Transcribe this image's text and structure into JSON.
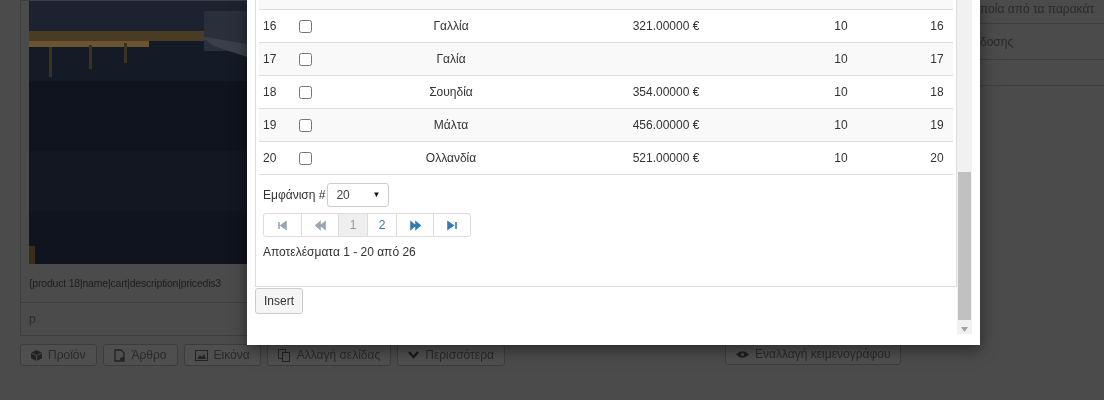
{
  "background": {
    "shortcode": "{product 18|name|cart|description|pricedis3",
    "paragraph_tag": "p",
    "right_texts": [
      "ποία από τα παρακάτ",
      "δοσης"
    ],
    "toolbar": [
      {
        "label": "Προϊόν"
      },
      {
        "label": "Άρθρο"
      },
      {
        "label": "Εικόνα"
      },
      {
        "label": "Αλλαγή σελίδας"
      },
      {
        "label": "Περισσότερα"
      }
    ],
    "toggle_editor": {
      "label": "Εναλλαγή κειμενογράφου"
    }
  },
  "dialog": {
    "rows": [
      {
        "id": "16",
        "checked": false,
        "name": "Γαλλία",
        "price": "321.00000 €",
        "quantity": "10",
        "column_6": "16"
      },
      {
        "id": "17",
        "checked": false,
        "name": "Γαλία",
        "price": "",
        "quantity": "10",
        "column_6": "17"
      },
      {
        "id": "18",
        "checked": false,
        "name": "Σουηδία",
        "price": "354.00000 €",
        "quantity": "10",
        "column_6": "18"
      },
      {
        "id": "19",
        "checked": false,
        "name": "Μάλτα",
        "price": "456.00000 €",
        "quantity": "10",
        "column_6": "19"
      },
      {
        "id": "20",
        "checked": false,
        "name": "Ολλανδία",
        "price": "521.00000 €",
        "quantity": "10",
        "column_6": "20"
      }
    ],
    "page_size": {
      "label": "Εμφάνιση #",
      "value": "20",
      "caret": "▼"
    },
    "pager": [
      {
        "kind": "first",
        "disabled": true
      },
      {
        "kind": "prev",
        "disabled": true
      },
      {
        "kind": "page",
        "label": "1",
        "selected": true
      },
      {
        "kind": "page",
        "label": "2",
        "selected": false
      },
      {
        "kind": "next",
        "disabled": false
      },
      {
        "kind": "last",
        "disabled": false
      }
    ],
    "results": "Αποτελέσματα 1 - 20 από 26",
    "insert_button": "Insert"
  }
}
